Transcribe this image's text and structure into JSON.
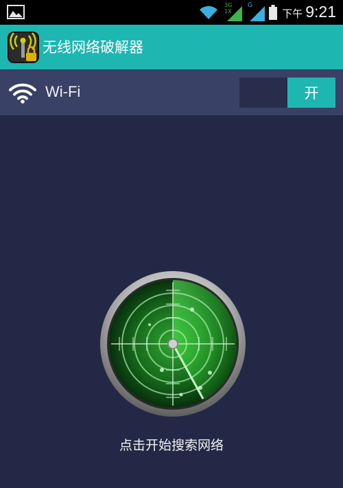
{
  "status_bar": {
    "network_1_label": "3G\n1X",
    "network_2_label": "G",
    "ampm": "下午",
    "time": "9:21",
    "icons": [
      "gallery-icon",
      "wifi-signal-icon",
      "cell-signal-icon",
      "cell-signal-icon",
      "battery-icon"
    ]
  },
  "action_bar": {
    "title": "无线网络破解器",
    "icon": "app-wifi-lock-icon"
  },
  "wifi_row": {
    "label": "Wi-Fi",
    "toggle_label": "开",
    "toggle_state": "on"
  },
  "radar": {
    "caption": "点击开始搜索网络",
    "icon": "radar-icon"
  },
  "colors": {
    "accent": "#1eb6b1",
    "background": "#222845",
    "row_background": "#3a4166"
  }
}
